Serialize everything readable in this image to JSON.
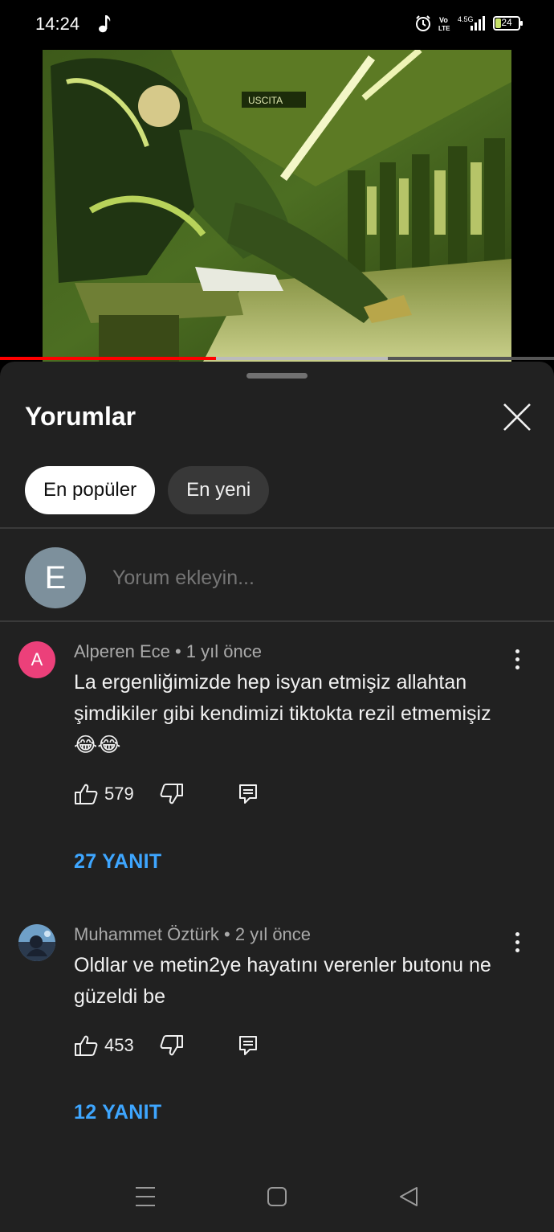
{
  "status_bar": {
    "time": "14:24",
    "network": "4.5G",
    "volte": "Vo LTE",
    "battery": "24",
    "battery_level": 0.24,
    "icons": [
      "music-note-icon",
      "alarm-icon",
      "volte-icon",
      "signal-icon",
      "battery-icon"
    ]
  },
  "video": {
    "sign_text": "USCITA",
    "progress_played": 0.39,
    "progress_buffered": 0.7
  },
  "comments_panel": {
    "title": "Yorumlar",
    "filters": [
      {
        "label": "En popüler",
        "active": true
      },
      {
        "label": "En yeni",
        "active": false
      }
    ],
    "add_comment": {
      "avatar_letter": "E",
      "placeholder": "Yorum ekleyin..."
    },
    "comments": [
      {
        "avatar_letter": "A",
        "avatar_color": "#ec407a",
        "meta": "Alperen Ece • 1 yıl önce",
        "text": "La ergenliğimizde hep isyan etmişiz allahtan şimdikiler gibi kendimizi tiktokta rezil etmemişiz 😂😂",
        "likes": "579",
        "replies": "27 YANIT"
      },
      {
        "meta": "Muhammet Öztürk • 2 yıl önce",
        "text": "Oldlar ve metin2ye hayatını verenler butonu ne güzeldi be",
        "likes": "453",
        "replies": "12 YANIT"
      }
    ]
  },
  "colors": {
    "accent_blue": "#3ea6ff",
    "progress_red": "#ff0000",
    "panel_bg": "#212121"
  }
}
